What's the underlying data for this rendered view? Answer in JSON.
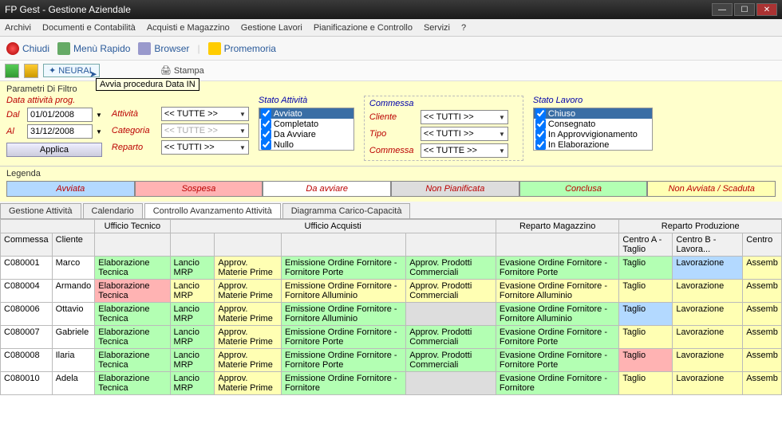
{
  "title": "FP Gest - Gestione Aziendale",
  "menubar": [
    "Archivi",
    "Documenti e Contabilità",
    "Acquisti e Magazzino",
    "Gestione Lavori",
    "Pianificazione e Controllo",
    "Servizi",
    "?"
  ],
  "toolbar1": {
    "chiudi": "Chiudi",
    "menu": "Menù Rapido",
    "browser": "Browser",
    "promem": "Promemoria"
  },
  "toolbar2": {
    "neural": "NEURAL",
    "stampa": "Stampa",
    "tooltip": "Avvia procedura Data IN"
  },
  "filters": {
    "hdr": "Parametri Di Filtro",
    "dataprog": "Data attività prog.",
    "dal": "Dal",
    "al": "Al",
    "d1": "01/01/2008",
    "d2": "31/12/2008",
    "attivita": "Attività",
    "categoria": "Categoria",
    "reparto": "Reparto",
    "tutte": "<< TUTTE >>",
    "tutti": "<< TUTTI >>",
    "applica": "Applica",
    "stato_att": "Stato Attività",
    "statoitems": [
      "Avviato",
      "Completato",
      "Da Avviare",
      "Nullo"
    ],
    "commessa": "Commessa",
    "cliente": "Cliente",
    "tipo": "Tipo",
    "commessa2": "Commessa",
    "statolav": "Stato Lavoro",
    "lavitems": [
      "Chiuso",
      "Consegnato",
      "In Approvvigionamento",
      "In Elaborazione"
    ]
  },
  "legend": {
    "t": "Legenda",
    "items": [
      "Avviata",
      "Sospesa",
      "Da avviare",
      "Non Pianificata",
      "Conclusa",
      "Non Avviata / Scaduta"
    ]
  },
  "tabs": [
    "Gestione Attività",
    "Calendario",
    "Controllo Avanzamento Attività",
    "Diagramma Carico-Capacità"
  ],
  "grid": {
    "groups": [
      "",
      "Ufficio Tecnico",
      "Ufficio Acquisti",
      "Reparto Magazzino",
      "Reparto Produzione"
    ],
    "cols": [
      "Commessa",
      "Cliente",
      "",
      "",
      "",
      "",
      "",
      "",
      "Centro A - Taglio",
      "Centro B - Lavora...",
      "Centro"
    ],
    "rows": [
      {
        "com": "C080001",
        "cli": "Marco",
        "cells": [
          {
            "t": "Elaborazione Tecnica",
            "c": "cg"
          },
          {
            "t": "Lancio MRP",
            "c": "cg"
          },
          {
            "t": "Approv. Materie Prime",
            "c": "cy"
          },
          {
            "t": "Emissione Ordine Fornitore - Fornitore Porte",
            "c": "cg"
          },
          {
            "t": "Approv. Prodotti Commerciali",
            "c": "cg"
          },
          {
            "t": "Evasione Ordine Fornitore - Fornitore Porte",
            "c": "cg"
          },
          {
            "t": "Taglio",
            "c": "cg"
          },
          {
            "t": "Lavorazione",
            "c": "cb"
          },
          {
            "t": "Assemb",
            "c": "cy"
          }
        ]
      },
      {
        "com": "C080004",
        "cli": "Armando",
        "cells": [
          {
            "t": "Elaborazione Tecnica",
            "c": "cr"
          },
          {
            "t": "Lancio MRP",
            "c": "cy"
          },
          {
            "t": "Approv. Materie Prime",
            "c": "cy"
          },
          {
            "t": "Emissione Ordine Fornitore - Fornitore Alluminio",
            "c": "cy"
          },
          {
            "t": "Approv. Prodotti Commerciali",
            "c": "cy"
          },
          {
            "t": "Evasione Ordine Fornitore - Fornitore Alluminio",
            "c": "cy"
          },
          {
            "t": "Taglio",
            "c": "cy"
          },
          {
            "t": "Lavorazione",
            "c": "cy"
          },
          {
            "t": "Assemb",
            "c": "cy"
          }
        ]
      },
      {
        "com": "C080006",
        "cli": "Ottavio",
        "cells": [
          {
            "t": "Elaborazione Tecnica",
            "c": "cg"
          },
          {
            "t": "Lancio MRP",
            "c": "cg"
          },
          {
            "t": "Approv. Materie Prime",
            "c": "cy"
          },
          {
            "t": "Emissione Ordine Fornitore - Fornitore Alluminio",
            "c": "cg"
          },
          {
            "t": "",
            "c": "cgr"
          },
          {
            "t": "Evasione Ordine Fornitore - Fornitore Alluminio",
            "c": "cg"
          },
          {
            "t": "Taglio",
            "c": "cb"
          },
          {
            "t": "Lavorazione",
            "c": "cy"
          },
          {
            "t": "Assemb",
            "c": "cy"
          }
        ]
      },
      {
        "com": "C080007",
        "cli": "Gabriele",
        "cells": [
          {
            "t": "Elaborazione Tecnica",
            "c": "cg"
          },
          {
            "t": "Lancio MRP",
            "c": "cg"
          },
          {
            "t": "Approv. Materie Prime",
            "c": "cy"
          },
          {
            "t": "Emissione Ordine Fornitore - Fornitore Porte",
            "c": "cg"
          },
          {
            "t": "Approv. Prodotti Commerciali",
            "c": "cg"
          },
          {
            "t": "Evasione Ordine Fornitore - Fornitore Porte",
            "c": "cg"
          },
          {
            "t": "Taglio",
            "c": "cy"
          },
          {
            "t": "Lavorazione",
            "c": "cy"
          },
          {
            "t": "Assemb",
            "c": "cy"
          }
        ]
      },
      {
        "com": "C080008",
        "cli": "Ilaria",
        "cells": [
          {
            "t": "Elaborazione Tecnica",
            "c": "cg"
          },
          {
            "t": "Lancio MRP",
            "c": "cg"
          },
          {
            "t": "Approv. Materie Prime",
            "c": "cy"
          },
          {
            "t": "Emissione Ordine Fornitore - Fornitore Porte",
            "c": "cg"
          },
          {
            "t": "Approv. Prodotti Commerciali",
            "c": "cg"
          },
          {
            "t": "Evasione Ordine Fornitore - Fornitore Porte",
            "c": "cg"
          },
          {
            "t": "Taglio",
            "c": "cr"
          },
          {
            "t": "Lavorazione",
            "c": "cy"
          },
          {
            "t": "Assemb",
            "c": "cy"
          }
        ]
      },
      {
        "com": "C080010",
        "cli": "Adela",
        "cells": [
          {
            "t": "Elaborazione Tecnica",
            "c": "cg"
          },
          {
            "t": "Lancio MRP",
            "c": "cg"
          },
          {
            "t": "Approv. Materie Prime",
            "c": "cy"
          },
          {
            "t": "Emissione Ordine Fornitore - Fornitore",
            "c": "cg"
          },
          {
            "t": "",
            "c": "cgr"
          },
          {
            "t": "Evasione Ordine Fornitore - Fornitore",
            "c": "cg"
          },
          {
            "t": "Taglio",
            "c": "cy"
          },
          {
            "t": "Lavorazione",
            "c": "cy"
          },
          {
            "t": "Assemb",
            "c": "cy"
          }
        ]
      }
    ]
  }
}
